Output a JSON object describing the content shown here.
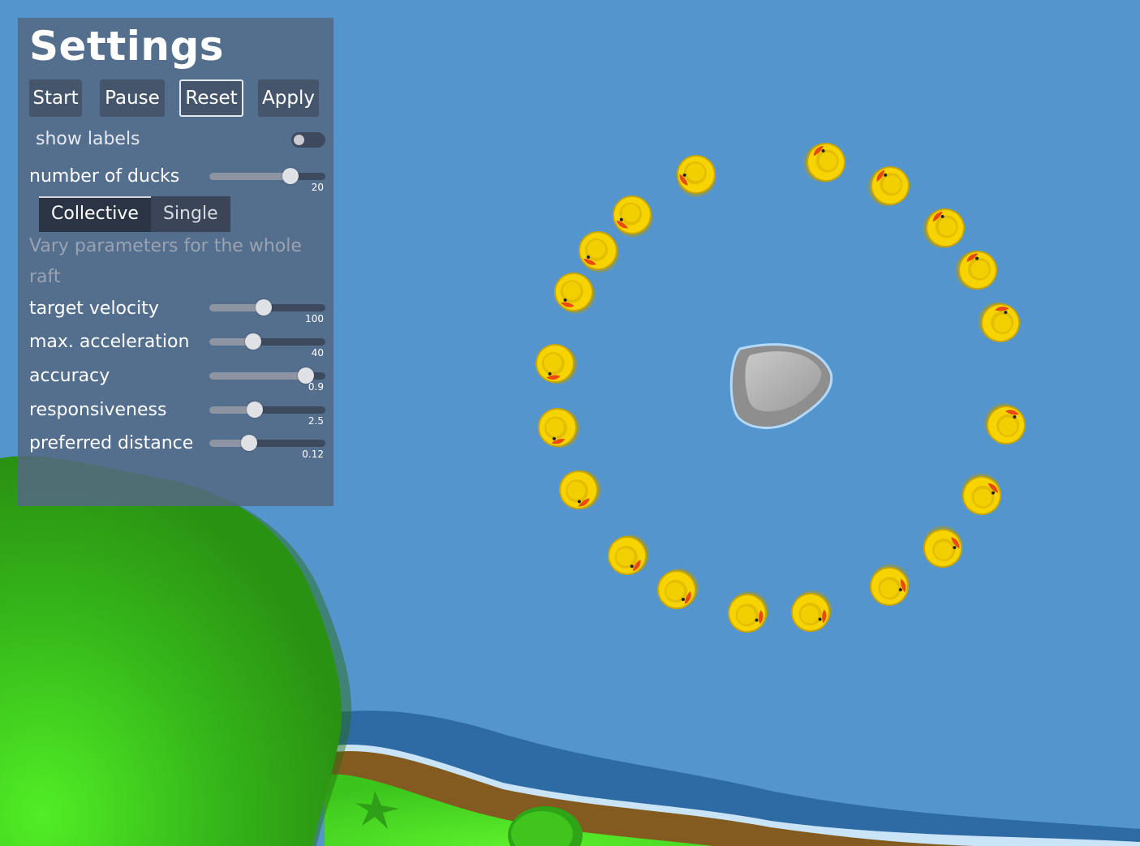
{
  "colors": {
    "water": "#5495cd",
    "grass": "#3bb81a",
    "duck_yellow": "#f7d400",
    "panel": "#546884"
  },
  "scene": {
    "rock_icon": "rock",
    "duck_icon": "rubber-duck",
    "duck_count": 20
  },
  "settings": {
    "title": "Settings",
    "buttons": {
      "start": "Start",
      "pause": "Pause",
      "reset": "Reset",
      "apply": "Apply"
    },
    "show_labels": {
      "label": "show labels",
      "on": false
    },
    "number_of_ducks": {
      "label": "number of ducks",
      "value": "20",
      "fraction": 0.7
    },
    "tabs": {
      "collective": "Collective",
      "single": "Single",
      "active": "Collective"
    },
    "description": "Vary parameters for the whole raft",
    "params": [
      {
        "label": "target velocity",
        "value": "100",
        "fraction": 0.47
      },
      {
        "label": "max. acceleration",
        "value": "40",
        "fraction": 0.38
      },
      {
        "label": "accuracy",
        "value": "0.9",
        "fraction": 0.83
      },
      {
        "label": "responsiveness",
        "value": "2.5",
        "fraction": 0.39
      },
      {
        "label": "preferred distance",
        "value": "0.12",
        "fraction": 0.34
      }
    ]
  }
}
